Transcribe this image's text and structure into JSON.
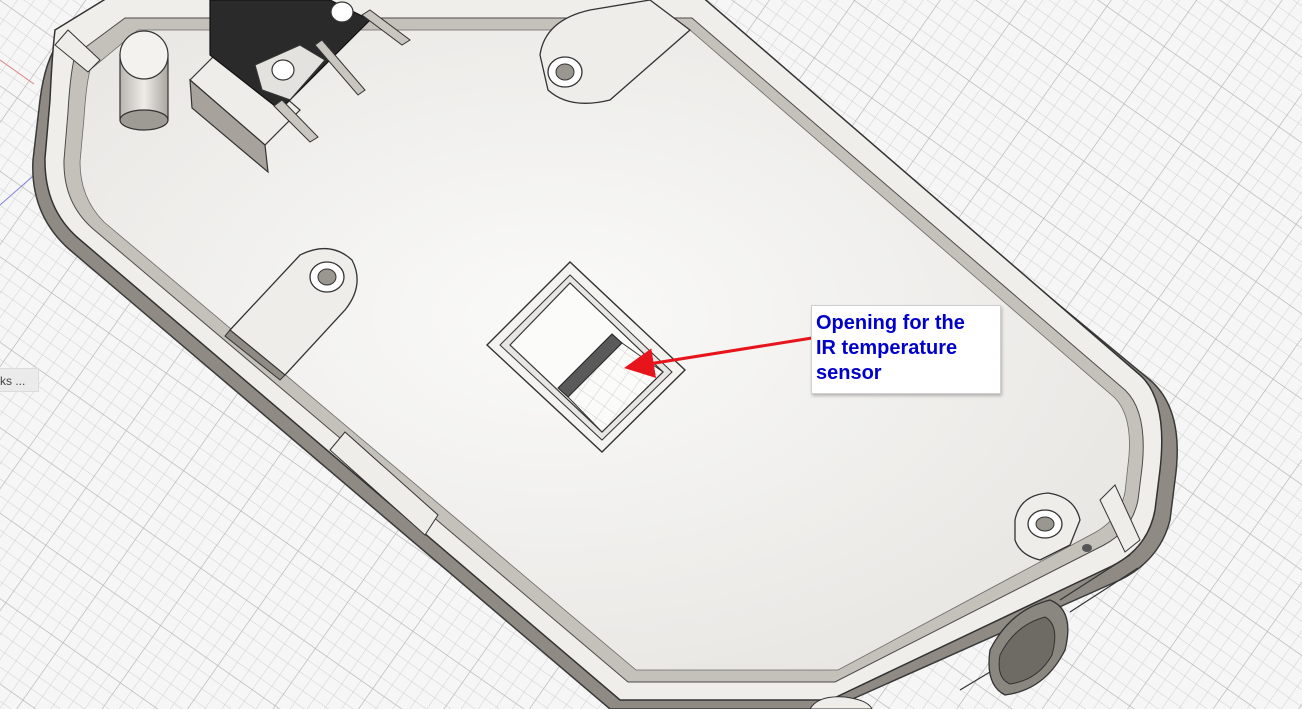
{
  "viewport": {
    "background": "#f6f6f6",
    "grid_color": "#c9c9c9",
    "model_color": "#efede9"
  },
  "browser_chip": {
    "label": "ks ..."
  },
  "annotation": {
    "text": "Opening for the\nIR temperature\nsensor",
    "text_color": "#0000cc",
    "arrow_color": "#e8141c"
  }
}
